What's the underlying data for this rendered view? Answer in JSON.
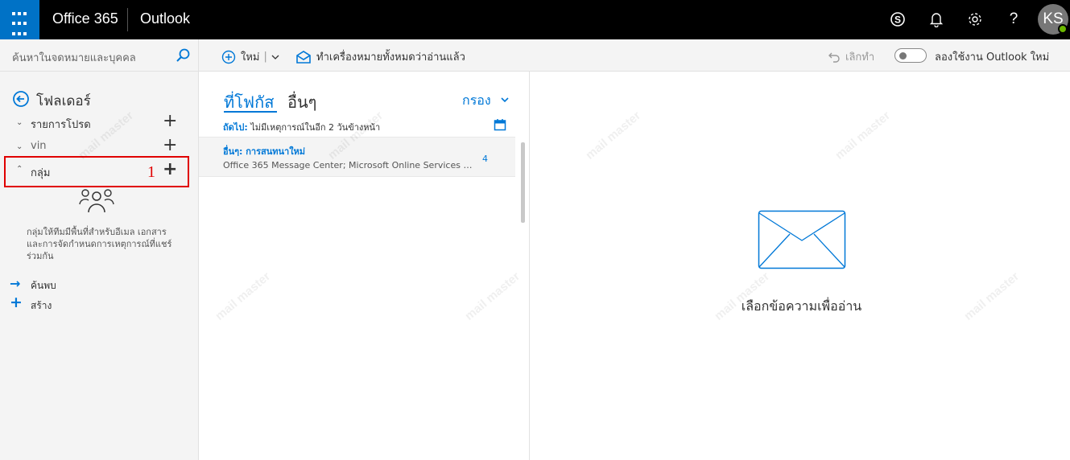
{
  "topbar": {
    "brand": "Office 365",
    "app": "Outlook",
    "avatar_initials": "KS",
    "icons": [
      "app-launcher-icon",
      "skype-icon",
      "bell-icon",
      "gear-icon",
      "help-icon"
    ]
  },
  "left": {
    "search_placeholder": "ค้นหาในจดหมายและบุคคล",
    "folders_title": "โฟลเดอร์",
    "sections": [
      {
        "label": "รายการโปรด"
      },
      {
        "label": "vin"
      },
      {
        "label": "กลุ่ม"
      }
    ],
    "annotation_number": "1",
    "groups_description": "กลุ่มให้ทีมมีพื้นที่สำหรับอีเมล เอกสาร และการจัดกำหนดการเหตุการณ์ที่แชร์ร่วมกัน",
    "actions": [
      {
        "label": "ค้นพบ"
      },
      {
        "label": "สร้าง"
      }
    ]
  },
  "commands": {
    "new_label": "ใหม่",
    "mark_all_read": "ทำเครื่องหมายทั้งหมดว่าอ่านแล้ว",
    "undo": "เลิกทำ",
    "try_new": "ลองใช้งาน Outlook ใหม่"
  },
  "message_list": {
    "tab_focused": "ที่โฟกัส",
    "tab_other": "อื่นๆ",
    "filter": "กรอง",
    "next_label": "ถัดไป:",
    "next_text": "ไม่มีเหตุการณ์ในอีก 2 วันข้างหน้า",
    "messages": [
      {
        "from": "อื่นๆ: การสนทนาใหม่",
        "preview": "Office 365 Message Center; Microsoft Online Services T...",
        "count": "4"
      }
    ]
  },
  "reading": {
    "empty_message": "เลือกข้อความเพื่ออ่าน"
  },
  "watermark": "mail master",
  "colors": {
    "accent": "#0078d7",
    "topbar": "#000000",
    "launcher": "#0072c6",
    "highlight": "#e00000"
  }
}
